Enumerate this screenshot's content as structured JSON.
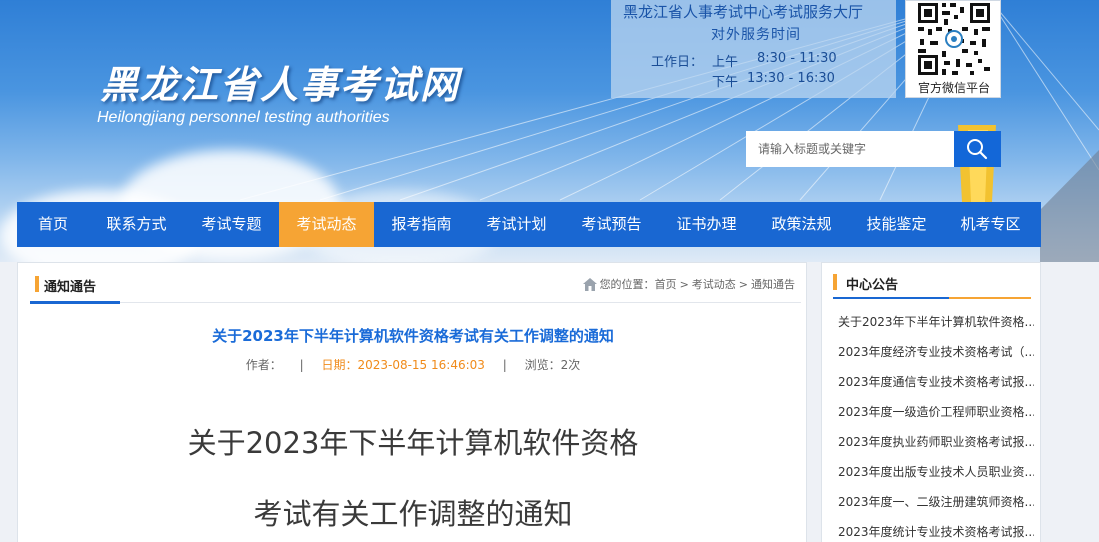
{
  "header": {
    "site_title": "黑龙江省人事考试网",
    "site_subtitle": "Heilongjiang personnel testing authorities",
    "service": {
      "title": "黑龙江省人事考试中心考试服务大厅",
      "subtitle": "对外服务时间",
      "workday_label": "工作日：",
      "morning_label": "上午",
      "morning_hours": "8:30 - 11:30",
      "afternoon_label": "下午",
      "afternoon_hours": "13:30 - 16:30"
    },
    "qr_label": "官方微信平台",
    "search_placeholder": "请输入标题或关键字"
  },
  "nav": {
    "active_index": 3,
    "items": [
      "首页",
      "联系方式",
      "考试专题",
      "考试动态",
      "报考指南",
      "考试计划",
      "考试预告",
      "证书办理",
      "政策法规",
      "技能鉴定",
      "机考专区"
    ]
  },
  "main": {
    "section_title": "通知通告",
    "breadcrumb": {
      "prefix": "您的位置：",
      "items": [
        "首页",
        "考试动态",
        "通知通告"
      ],
      "separator": ">"
    },
    "article": {
      "title": "关于2023年下半年计算机软件资格考试有关工作调整的通知",
      "author_label": "作者：",
      "date": "日期：2023-08-15 16:46:03",
      "views": "浏览：2次",
      "separator": "|",
      "heading_line1": "关于2023年下半年计算机软件资格",
      "heading_line2": "考试有关工作调整的通知"
    }
  },
  "sidebar": {
    "title": "中心公告",
    "items": [
      "关于2023年下半年计算机软件资格...",
      "2023年度经济专业技术资格考试（...",
      "2023年度通信专业技术资格考试报...",
      "2023年度一级造价工程师职业资格...",
      "2023年度执业药师职业资格考试报...",
      "2023年度出版专业技术人员职业资...",
      "2023年度一、二级注册建筑师资格...",
      "2023年度统计专业技术资格考试报..."
    ]
  },
  "colors": {
    "nav_bg": "#1967d2",
    "nav_active": "#f6a434",
    "title_blue": "#1a6bd8",
    "date_orange": "#f08b1b"
  },
  "icons": {
    "search": "search-icon",
    "home": "home-icon",
    "qr": "qr-code-icon"
  }
}
